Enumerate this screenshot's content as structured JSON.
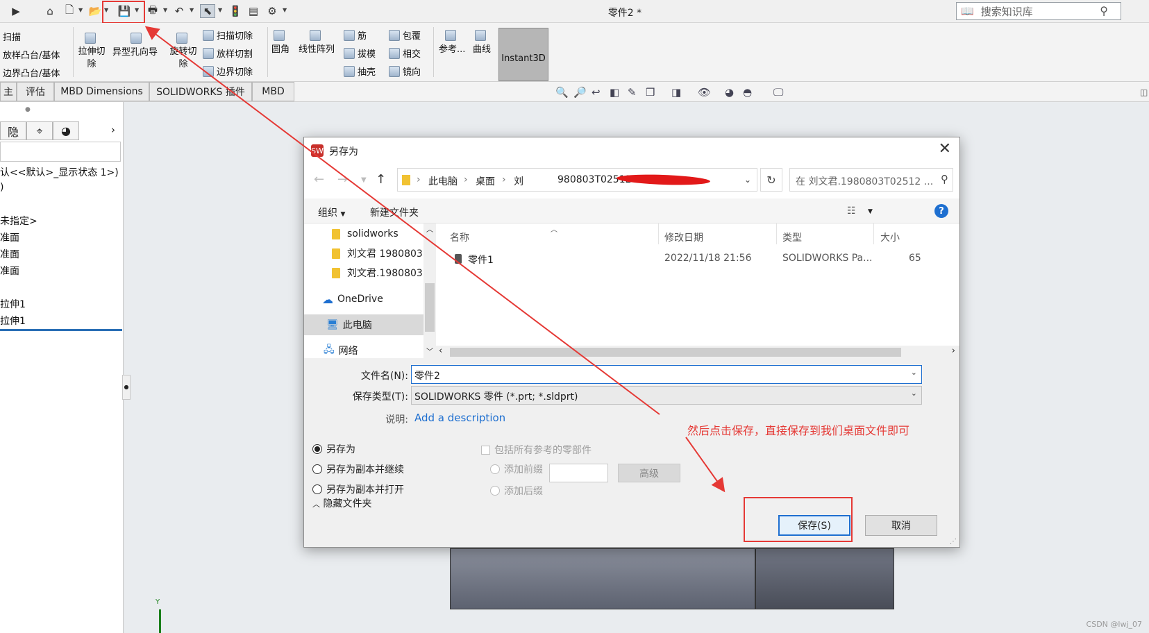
{
  "titlebar": {
    "document_title": "零件2 *",
    "knowledge_search_placeholder": "搜索知识库"
  },
  "ribbon": {
    "sweep": "扫描",
    "loft_boss": "放样凸台/基体",
    "boundary_boss": "边界凸台/基体",
    "extruded_cut": "拉伸切除",
    "hole_wizard": "异型孔向导",
    "revolved_cut": "旋转切除",
    "swept_cut": "扫描切除",
    "lofted_cut": "放样切割",
    "boundary_cut": "边界切除",
    "fillet": "圆角",
    "linear_pattern": "线性阵列",
    "rib": "筋",
    "draft": "拔模",
    "shell": "抽壳",
    "wrap": "包覆",
    "intersect": "相交",
    "mirror": "镜向",
    "reference": "参考...",
    "curves": "曲线",
    "instant3d": "Instant3D"
  },
  "tabs": [
    {
      "label": "主"
    },
    {
      "label": "评估"
    },
    {
      "label": "MBD Dimensions"
    },
    {
      "label": "SOLIDWORKS 插件"
    },
    {
      "label": "MBD"
    }
  ],
  "tree": {
    "hide_tab_label": "隐",
    "config_line": "认<<默认>_显示状态 1>)",
    "paren_line": ")",
    "material_line": "未指定>",
    "plane_1": "准面",
    "plane_2": "准面",
    "plane_3": "准面",
    "extrude_1": "拉伸1",
    "extrude_2": "拉伸1"
  },
  "dialog": {
    "title": "另存为",
    "breadcrumb": [
      "此电脑",
      "桌面",
      "刘"
    ],
    "breadcrumb_tail": "980803T02512",
    "search_placeholder": "在 刘文君.1980803T02512 ...",
    "organize": "组织",
    "new_folder": "新建文件夹",
    "nav_items": [
      {
        "label": "solidworks"
      },
      {
        "label": "刘文君 1980803"
      },
      {
        "label": "刘文君.1980803"
      },
      {
        "label": "OneDrive"
      },
      {
        "label": "此电脑"
      },
      {
        "label": "网络"
      }
    ],
    "columns": {
      "name": "名称",
      "date": "修改日期",
      "type": "类型",
      "size": "大小"
    },
    "files": [
      {
        "name": "零件1",
        "date": "2022/11/18 21:56",
        "type": "SOLIDWORKS Pa...",
        "size": "65"
      }
    ],
    "file_name_label": "文件名(N):",
    "file_name_value": "零件2",
    "file_type_label": "保存类型(T):",
    "file_type_value": "SOLIDWORKS 零件 (*.prt; *.sldprt)",
    "description_label": "说明:",
    "description_link": "Add a description",
    "radio_save_as": "另存为",
    "radio_save_copy_continue": "另存为副本并继续",
    "radio_save_copy_open": "另存为副本并打开",
    "include_refs": "包括所有参考的零部件",
    "add_prefix": "添加前缀",
    "add_suffix": "添加后缀",
    "advanced": "高级",
    "save": "保存(S)",
    "cancel": "取消",
    "hide_folders": "隐藏文件夹"
  },
  "annotation": "然后点击保存，直接保存到我们桌面文件即可",
  "watermark": "CSDN @lwj_07",
  "colors": {
    "annotation_red": "#e53935",
    "accent_blue": "#1e6fd0"
  }
}
